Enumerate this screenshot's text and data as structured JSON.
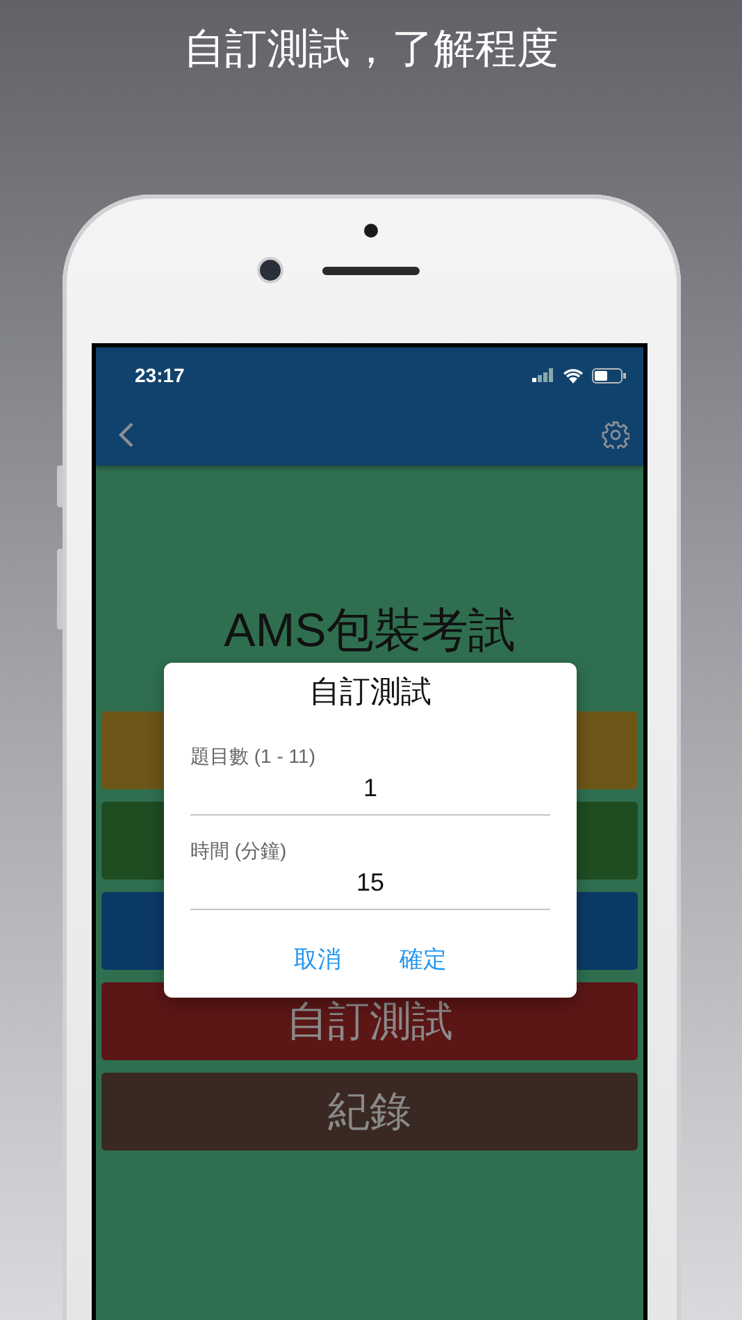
{
  "caption": "自訂測試，了解程度",
  "status_bar": {
    "time": "23:17"
  },
  "screen": {
    "heading": "AMS包裝考試",
    "menu_buttons": [
      {
        "color": "#6e5618"
      },
      {
        "color": "#1f4d22"
      },
      {
        "color": "#0c3a66"
      },
      {
        "label": "自訂測試",
        "color": "#5c1616"
      },
      {
        "label": "紀錄",
        "color": "#3a2822"
      }
    ]
  },
  "dialog": {
    "title": "自訂測試",
    "fields": [
      {
        "label": "題目數 (1 - 11)",
        "value": "1"
      },
      {
        "label": "時間 (分鐘)",
        "value": "15"
      }
    ],
    "buttons": [
      "取消",
      "確定"
    ]
  }
}
